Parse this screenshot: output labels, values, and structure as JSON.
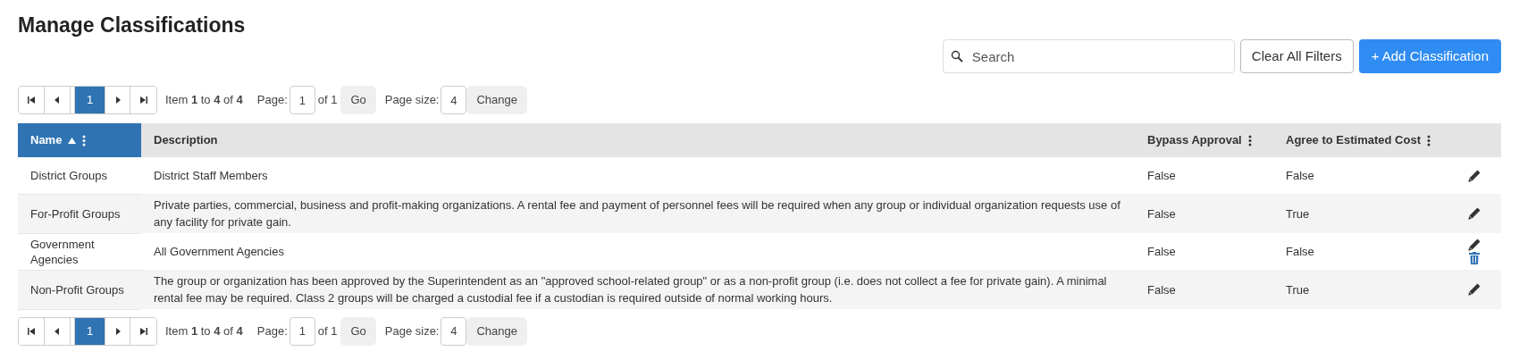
{
  "title": "Manage Classifications",
  "search": {
    "placeholder": "Search"
  },
  "buttons": [
    {
      "label": "Clear All Filters",
      "kind": "outline"
    },
    {
      "label": "+ Add Classification",
      "kind": "primary"
    }
  ],
  "pagers": [
    {
      "pages": [
        {
          "label": "1",
          "selected": true
        }
      ],
      "summary": "Item **1** to **4** of **4**",
      "page_label": "Page:",
      "page_value": "1",
      "page_of": "of 1",
      "go": "Go",
      "size_label": "Page size:",
      "size_value": "4",
      "change": "Change"
    },
    {
      "pages": [
        {
          "label": "1",
          "selected": true
        }
      ],
      "summary": "Item **1** to **4** of **4**",
      "page_label": "Page:",
      "page_value": "1",
      "page_of": "of 1",
      "go": "Go",
      "size_label": "Page size:",
      "size_value": "4",
      "change": "Change"
    }
  ],
  "table": {
    "columns": [
      {
        "label": "Name",
        "sorted": true,
        "menu": true
      },
      {
        "label": "Description",
        "sorted": false,
        "menu": false
      },
      {
        "label": "Bypass Approval",
        "sorted": false,
        "menu": true
      },
      {
        "label": "Agree to Estimated Cost",
        "sorted": false,
        "menu": true
      }
    ],
    "rows": [
      {
        "cells": [
          "District Groups",
          "District Staff Members",
          "False",
          "False"
        ],
        "deletable": false
      },
      {
        "cells": [
          "For-Profit Groups",
          "Private parties, commercial, business and profit-making organizations. A rental fee and payment of personnel fees will be required when any group or individual organization requests use of any facility for private gain.",
          "False",
          "True"
        ],
        "deletable": false
      },
      {
        "cells": [
          "Government Agencies",
          "All Government Agencies",
          "False",
          "False"
        ],
        "deletable": true
      },
      {
        "cells": [
          "Non-Profit Groups",
          "The group or organization has been approved by the Superintendent as an \"approved school-related group\" or as a non-profit group (i.e. does not collect a fee for private gain). A minimal rental fee may be required. Class 2 groups will be charged a custodial fee if a custodian is required outside of normal working hours.",
          "False",
          "True"
        ],
        "deletable": false
      }
    ]
  }
}
